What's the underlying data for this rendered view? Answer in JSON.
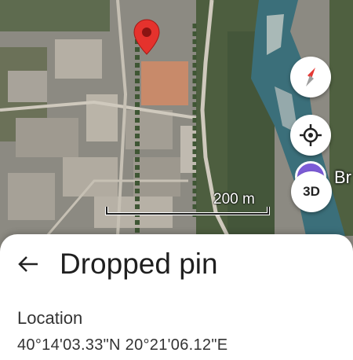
{
  "map": {
    "scale_label": "200 m",
    "poi_label": "Br",
    "pin_color": "#e5322d",
    "icons": [
      "map-pin-icon",
      "compass-icon",
      "my-location-icon"
    ]
  },
  "controls": {
    "three_d_label": "3D"
  },
  "sheet": {
    "title": "Dropped pin",
    "location_label": "Location",
    "coordinates": "40°14'03.33\"N 20°21'06.12\"E"
  }
}
